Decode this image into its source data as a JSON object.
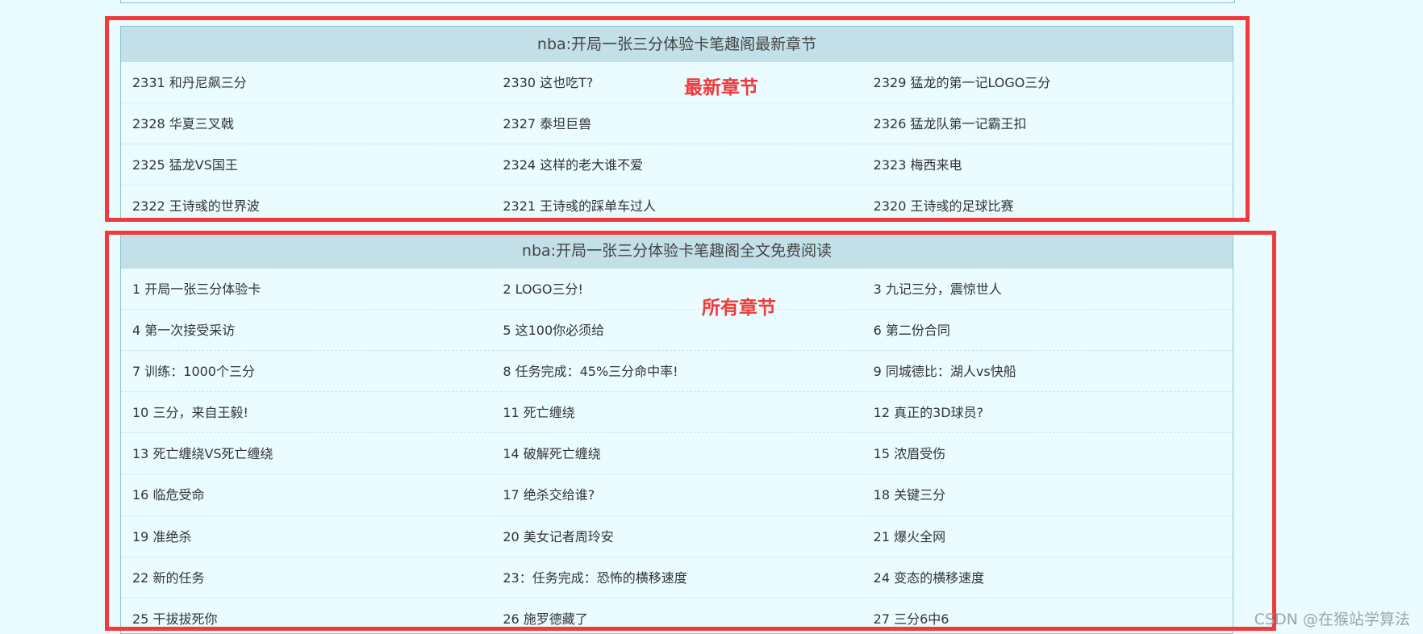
{
  "latest": {
    "title": "nba:开局一张三分体验卡笔趣阁最新章节",
    "annotation": "最新章节",
    "rows": [
      [
        "2331 和丹尼飙三分",
        "2330 这也吃T?",
        "2329 猛龙的第一记LOGO三分"
      ],
      [
        "2328 华夏三叉戟",
        "2327 泰坦巨兽",
        "2326 猛龙队第一记霸王扣"
      ],
      [
        "2325 猛龙VS国王",
        "2324 这样的老大谁不爱",
        "2323 梅西来电"
      ],
      [
        "2322 王诗彧的世界波",
        "2321 王诗彧的踩单车过人",
        "2320 王诗彧的足球比赛"
      ]
    ]
  },
  "all": {
    "title": "nba:开局一张三分体验卡笔趣阁全文免费阅读",
    "annotation": "所有章节",
    "rows": [
      [
        "1 开局一张三分体验卡",
        "2 LOGO三分!",
        "3 九记三分，震惊世人"
      ],
      [
        "4 第一次接受采访",
        "5 这100你必须给",
        "6 第二份合同"
      ],
      [
        "7 训练：1000个三分",
        "8 任务完成：45%三分命中率!",
        "9 同城德比：湖人vs快船"
      ],
      [
        "10 三分，来自王毅!",
        "11 死亡缠绕",
        "12 真正的3D球员?"
      ],
      [
        "13 死亡缠绕VS死亡缠绕",
        "14 破解死亡缠绕",
        "15 浓眉受伤"
      ],
      [
        "16 临危受命",
        "17 绝杀交给谁?",
        "18 关键三分"
      ],
      [
        "19 准绝杀",
        "20 美女记者周玲安",
        "21 爆火全网"
      ],
      [
        "22 新的任务",
        "23：任务完成：恐怖的横移速度",
        "24 变态的横移速度"
      ],
      [
        "25 干拔拔死你",
        "26 施罗德藏了",
        "27 三分6中6"
      ]
    ]
  },
  "watermark": "CSDN @在猴站学算法",
  "colors": {
    "background": "#eafcff",
    "header": "#c3e0e9",
    "border": "#88c6d6",
    "annotation_red": "#f23a3a"
  }
}
